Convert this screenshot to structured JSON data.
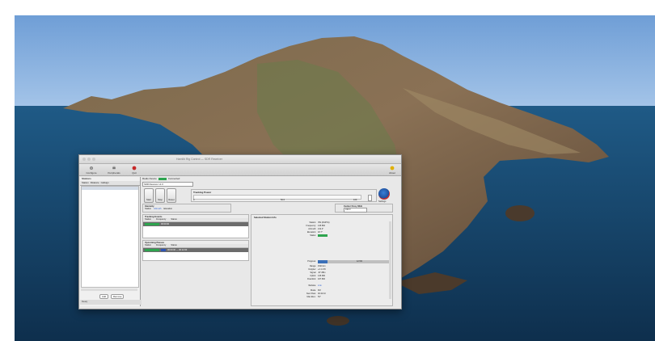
{
  "window": {
    "title": "Hamlib Rig Control — SDR Receiver",
    "toolbar": {
      "configure": "Configure",
      "peripherals": "Peripherals",
      "quit": "Quit",
      "about": "About"
    }
  },
  "sidebar": {
    "header": "Stations",
    "columns": [
      "Station",
      "Distance",
      "Callsign"
    ],
    "buttons": [
      "Add",
      "Remove"
    ],
    "status": "Ready"
  },
  "main": {
    "top_label": "Radio Device",
    "top_status": "Connected",
    "selector": "SDR Receiver v1.0",
    "buttons": [
      "Start",
      "Stop",
      "Reset"
    ],
    "power": {
      "label": "Tracking Power",
      "min": "0",
      "mid": "50.0",
      "max": "100"
    },
    "about_label": "Settings",
    "intensity": {
      "header": "Intensity",
      "items": [
        "Station",
        "Azimuth",
        "Elevation"
      ]
    },
    "center_freq": {
      "header": "Center Freq. MHz",
      "value": "433.0"
    },
    "tracked": {
      "header": "Tracking Events",
      "cols": [
        "Station",
        "Frequency",
        "Status"
      ],
      "row_label": "00:00:00"
    },
    "passes": {
      "header": "Upcoming Passes",
      "cols": [
        "Station",
        "Frequency",
        "Status"
      ],
      "row_label": "00:00:00 — 00:12:00"
    },
    "info": {
      "header": "Selected Station Info",
      "rows": [
        {
          "k": "Station:",
          "v": "ISS (ZARYA)"
        },
        {
          "k": "Frequency:",
          "v": "145.800"
        },
        {
          "k": "Azimuth:",
          "v": "212.4°"
        },
        {
          "k": "Elevation:",
          "v": "18.7°"
        },
        {
          "k": "Status:",
          "v": ""
        }
      ],
      "progress_label": "Progress:",
      "progress_text": "12.5%",
      "progress_value": 0.13,
      "rows2": [
        {
          "k": "Range:",
          "v": "1520 km"
        },
        {
          "k": "Doppler:",
          "v": "+2.1 kHz"
        },
        {
          "k": "Signal:",
          "v": "-87 dBm"
        },
        {
          "k": "Uplink:",
          "v": "145.990"
        },
        {
          "k": "Downlink:",
          "v": "437.800"
        }
      ],
      "link_label": "Website:",
      "link_value": "Link",
      "rows3": [
        {
          "k": "Mode:",
          "v": "FM"
        },
        {
          "k": "Next Pass:",
          "v": "00:42:10"
        },
        {
          "k": "Max Elev.:",
          "v": "54°"
        }
      ]
    },
    "bottom_nums": [
      "10",
      "25",
      "50",
      "100"
    ]
  },
  "colors": {
    "ok_green": "#2ea44f",
    "progress_blue": "#3a6fb8",
    "row_selected": "#6c6c6c"
  }
}
